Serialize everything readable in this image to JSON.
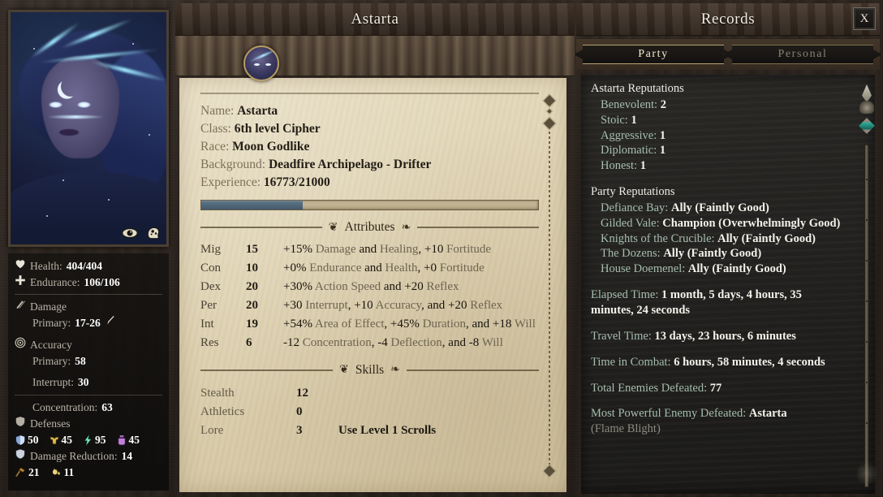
{
  "character_panel": {
    "title": "Astarta",
    "portrait_icons": [
      "eye-icon",
      "mind-icon"
    ],
    "info": [
      {
        "key": "Name:",
        "value": "Astarta"
      },
      {
        "key": "Class:",
        "value": "6th level Cipher"
      },
      {
        "key": "Race:",
        "value": "Moon Godlike"
      },
      {
        "key": "Background:",
        "value": "Deadfire Archipelago - Drifter"
      },
      {
        "key": "Experience:",
        "value": "16773/21000"
      }
    ],
    "xp_fill_percent": 30,
    "attributes_heading": "Attributes",
    "attributes": [
      {
        "name": "Mig",
        "value": "15",
        "effect_parts": [
          {
            "t": "+15% ",
            "kw": false
          },
          {
            "t": "Damage",
            "kw": true
          },
          {
            "t": " and ",
            "kw": false
          },
          {
            "t": "Healing",
            "kw": true
          },
          {
            "t": ", +10 ",
            "kw": false
          },
          {
            "t": "Fortitude",
            "kw": true
          }
        ]
      },
      {
        "name": "Con",
        "value": "10",
        "effect_parts": [
          {
            "t": "+0% ",
            "kw": false
          },
          {
            "t": "Endurance",
            "kw": true
          },
          {
            "t": " and ",
            "kw": false
          },
          {
            "t": "Health",
            "kw": true
          },
          {
            "t": ", +0 ",
            "kw": false
          },
          {
            "t": "Fortitude",
            "kw": true
          }
        ]
      },
      {
        "name": "Dex",
        "value": "20",
        "effect_parts": [
          {
            "t": "+30% ",
            "kw": false
          },
          {
            "t": "Action Speed",
            "kw": true
          },
          {
            "t": " and +20 ",
            "kw": false
          },
          {
            "t": "Reflex",
            "kw": true
          }
        ]
      },
      {
        "name": "Per",
        "value": "20",
        "effect_parts": [
          {
            "t": "+30 ",
            "kw": false
          },
          {
            "t": "Interrupt",
            "kw": true
          },
          {
            "t": ", +10 ",
            "kw": false
          },
          {
            "t": "Accuracy",
            "kw": true
          },
          {
            "t": ", and +20 ",
            "kw": false
          },
          {
            "t": "Reflex",
            "kw": true
          }
        ]
      },
      {
        "name": "Int",
        "value": "19",
        "effect_parts": [
          {
            "t": "+54% ",
            "kw": false
          },
          {
            "t": "Area of Effect",
            "kw": true
          },
          {
            "t": ", +45% ",
            "kw": false
          },
          {
            "t": "Duration",
            "kw": true
          },
          {
            "t": ", and +18 ",
            "kw": false
          },
          {
            "t": "Will",
            "kw": true
          }
        ]
      },
      {
        "name": "Res",
        "value": "6",
        "effect_parts": [
          {
            "t": "-12 ",
            "kw": false
          },
          {
            "t": "Concentration",
            "kw": true
          },
          {
            "t": ", -4 ",
            "kw": false
          },
          {
            "t": "Deflection",
            "kw": true
          },
          {
            "t": ", and -8 ",
            "kw": false
          },
          {
            "t": "Will",
            "kw": true
          }
        ]
      }
    ],
    "skills_heading": "Skills",
    "skills": [
      {
        "name": "Stealth",
        "value": "12",
        "note": ""
      },
      {
        "name": "Athletics",
        "value": "0",
        "note": ""
      },
      {
        "name": "Lore",
        "value": "3",
        "note": "Use Level 1 Scrolls"
      }
    ]
  },
  "stats_panel": {
    "health_label": "Health:",
    "health_value": "404/404",
    "endurance_label": "Endurance:",
    "endurance_value": "106/106",
    "damage_label": "Damage",
    "damage_primary_label": "Primary:",
    "damage_primary_value": "17-26",
    "accuracy_label": "Accuracy",
    "accuracy_primary_label": "Primary:",
    "accuracy_primary_value": "58",
    "interrupt_label": "Interrupt:",
    "interrupt_value": "30",
    "concentration_label": "Concentration:",
    "concentration_value": "63",
    "defenses_label": "Defenses",
    "defenses": [
      {
        "icon": "deflection-shield-icon",
        "value": "50",
        "color": "#8ba9d6"
      },
      {
        "icon": "fortitude-armor-icon",
        "value": "45",
        "color": "#e0bb4a"
      },
      {
        "icon": "reflex-bolt-icon",
        "value": "95",
        "color": "#79e6b8"
      },
      {
        "icon": "will-potion-icon",
        "value": "45",
        "color": "#c080d8"
      }
    ],
    "damage_reduction_label": "Damage Reduction:",
    "damage_reduction_value": "14",
    "dr_extra": [
      {
        "icon": "crush-hammer-icon",
        "value": "21",
        "color": "#c3872f"
      },
      {
        "icon": "burn-flame-icon",
        "value": "11",
        "color": "#e8d27a"
      }
    ]
  },
  "records_panel": {
    "title": "Records",
    "close_label": "X",
    "tabs": [
      {
        "label": "Party",
        "active": true
      },
      {
        "label": "Personal",
        "active": false
      }
    ],
    "character_reputations_heading": "Astarta Reputations",
    "character_reputations": [
      {
        "key": "Benevolent:",
        "value": "2"
      },
      {
        "key": "Stoic:",
        "value": "1"
      },
      {
        "key": "Aggressive:",
        "value": "1"
      },
      {
        "key": "Diplomatic:",
        "value": "1"
      },
      {
        "key": "Honest:",
        "value": "1"
      }
    ],
    "party_reputations_heading": "Party Reputations",
    "party_reputations": [
      {
        "key": "Defiance Bay:",
        "value": "Ally (Faintly Good)"
      },
      {
        "key": "Gilded Vale:",
        "value": "Champion (Overwhelmingly Good)"
      },
      {
        "key": "Knights of the Crucible:",
        "value": "Ally (Faintly Good)"
      },
      {
        "key": "The Dozens:",
        "value": "Ally (Faintly Good)"
      },
      {
        "key": "House Doemenel:",
        "value": "Ally (Faintly Good)"
      }
    ],
    "stats": [
      {
        "key": "Elapsed Time:",
        "value": "1 month, 5 days, 4 hours, 35 minutes, 24 seconds"
      },
      {
        "key": "Travel Time:",
        "value": "13 days, 23 hours, 6 minutes"
      },
      {
        "key": "Time in Combat:",
        "value": "6 hours, 58 minutes, 4 seconds"
      },
      {
        "key": "Total Enemies Defeated:",
        "value": "77"
      },
      {
        "key": "Most Powerful Enemy Defeated:",
        "value": "Astarta"
      }
    ],
    "trailing_line": "(Flame Blight)"
  }
}
